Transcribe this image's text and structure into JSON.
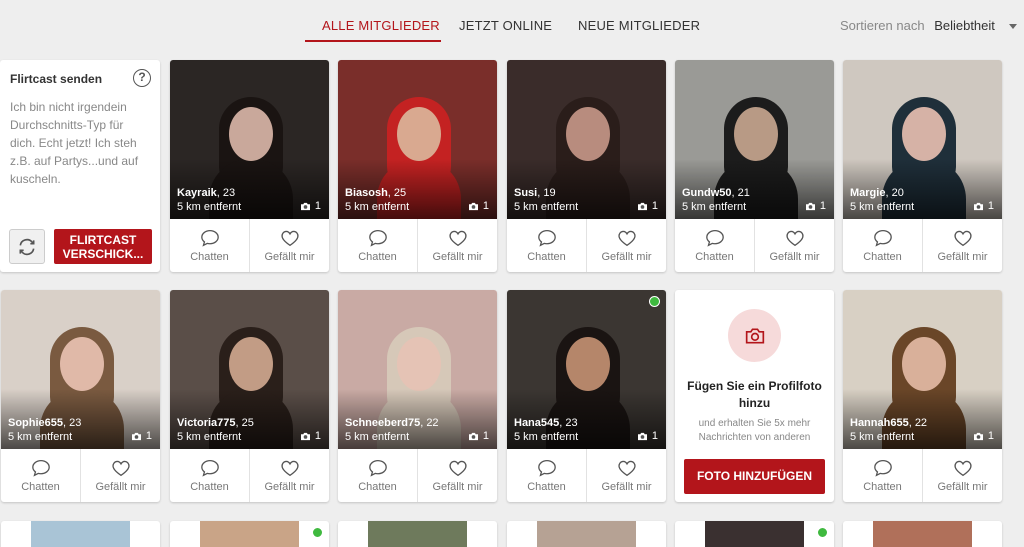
{
  "tabs": [
    {
      "label": "ALLE MITGLIEDER",
      "active": true
    },
    {
      "label": "JETZT ONLINE",
      "active": false
    },
    {
      "label": "NEUE MITGLIEDER",
      "active": false
    }
  ],
  "sort": {
    "label": "Sortieren nach",
    "value": "Beliebtheit"
  },
  "flirtcast": {
    "title": "Flirtcast senden",
    "help": "?",
    "text": "Ich bin nicht irgendein Durchschnitts-Typ für dich. Echt jetzt! Ich steh z.B. auf Partys...und auf kuscheln.",
    "button_line1": "FLIRTCAST",
    "button_line2": "VERSCHICK..."
  },
  "actions": {
    "chat": "Chatten",
    "like": "Gefällt mir"
  },
  "profiles": [
    {
      "name": "Kayraik",
      "age": ", 23",
      "distance": "5 km entfernt",
      "photos": "1",
      "online": false,
      "bg": "#2b2624",
      "skin": "#c9a89b",
      "hair": "#1a1412"
    },
    {
      "name": "Biasosh",
      "age": ", 25",
      "distance": "5 km entfernt",
      "photos": "1",
      "online": false,
      "bg": "#7a2e2a",
      "skin": "#d9a990",
      "hair": "#c42222"
    },
    {
      "name": "Susi",
      "age": ", 19",
      "distance": "5 km entfernt",
      "photos": "1",
      "online": false,
      "bg": "#3a2c2a",
      "skin": "#b88c7e",
      "hair": "#2a1d1a"
    },
    {
      "name": "Gundw50",
      "age": ", 21",
      "distance": "5 km entfernt",
      "photos": "1",
      "online": false,
      "bg": "#9a9a96",
      "skin": "#b89a85",
      "hair": "#1c1c1c"
    },
    {
      "name": "Margie",
      "age": ", 20",
      "distance": "5 km entfernt",
      "photos": "1",
      "online": false,
      "bg": "#cfc8c0",
      "skin": "#d6b2a6",
      "hair": "#1f2f3a"
    },
    {
      "name": "Sophie655",
      "age": ", 23",
      "distance": "5 km entfernt",
      "photos": "1",
      "online": false,
      "bg": "#d9d0c8",
      "skin": "#e0b9a8",
      "hair": "#7a5a40"
    },
    {
      "name": "Victoria775",
      "age": ", 25",
      "distance": "5 km entfernt",
      "photos": "1",
      "online": false,
      "bg": "#5a4e48",
      "skin": "#c29c85",
      "hair": "#2a1f1a"
    },
    {
      "name": "Schneeberd75",
      "age": ", 22",
      "distance": "5 km entfernt",
      "photos": "1",
      "online": false,
      "bg": "#c9aaa4",
      "skin": "#e5c3b5",
      "hair": "#d6c8b8"
    },
    {
      "name": "Hana545",
      "age": ", 23",
      "distance": "5 km entfernt",
      "photos": "1",
      "online": true,
      "bg": "#3b3632",
      "skin": "#b5866a",
      "hair": "#1a1412"
    },
    {
      "name": "Hannah655",
      "age": ", 22",
      "distance": "5 km entfernt",
      "photos": "1",
      "online": false,
      "bg": "#d8d0c4",
      "skin": "#d9b09a",
      "hair": "#6a4628"
    }
  ],
  "add_photo": {
    "title": "Fügen Sie ein Profilfoto hinzu",
    "subtitle": "und erhalten Sie 5x mehr Nachrichten von anderen",
    "button": "FOTO HINZUFÜGEN"
  },
  "peek_rows": [
    {
      "bg": "#a9c4d6",
      "online": false
    },
    {
      "bg": "#c9a487",
      "online": true
    },
    {
      "bg": "#6e7a5c",
      "online": false
    },
    {
      "bg": "#b6a294",
      "online": false
    },
    {
      "bg": "#3a3030",
      "online": true
    },
    {
      "bg": "#b0705a",
      "online": false
    }
  ],
  "colors": {
    "accent": "#b3151b",
    "online": "#3fb93f"
  }
}
